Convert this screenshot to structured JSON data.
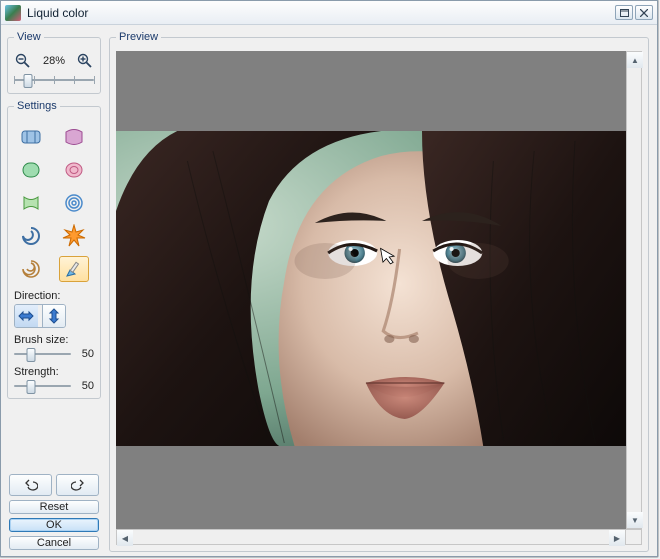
{
  "window": {
    "title": "Liquid color"
  },
  "view": {
    "legend": "View",
    "zoom_text": "28%",
    "zoom_pos_pct": 18
  },
  "settings": {
    "legend": "Settings",
    "selected_tool_index": 9,
    "direction": {
      "label": "Direction:",
      "selected": 0
    },
    "brush_size": {
      "label": "Brush size:",
      "value": "50",
      "pos_pct": 30
    },
    "strength": {
      "label": "Strength:",
      "value": "50",
      "pos_pct": 30
    }
  },
  "buttons": {
    "reset": "Reset",
    "ok": "OK",
    "cancel": "Cancel"
  },
  "preview": {
    "legend": "Preview"
  }
}
